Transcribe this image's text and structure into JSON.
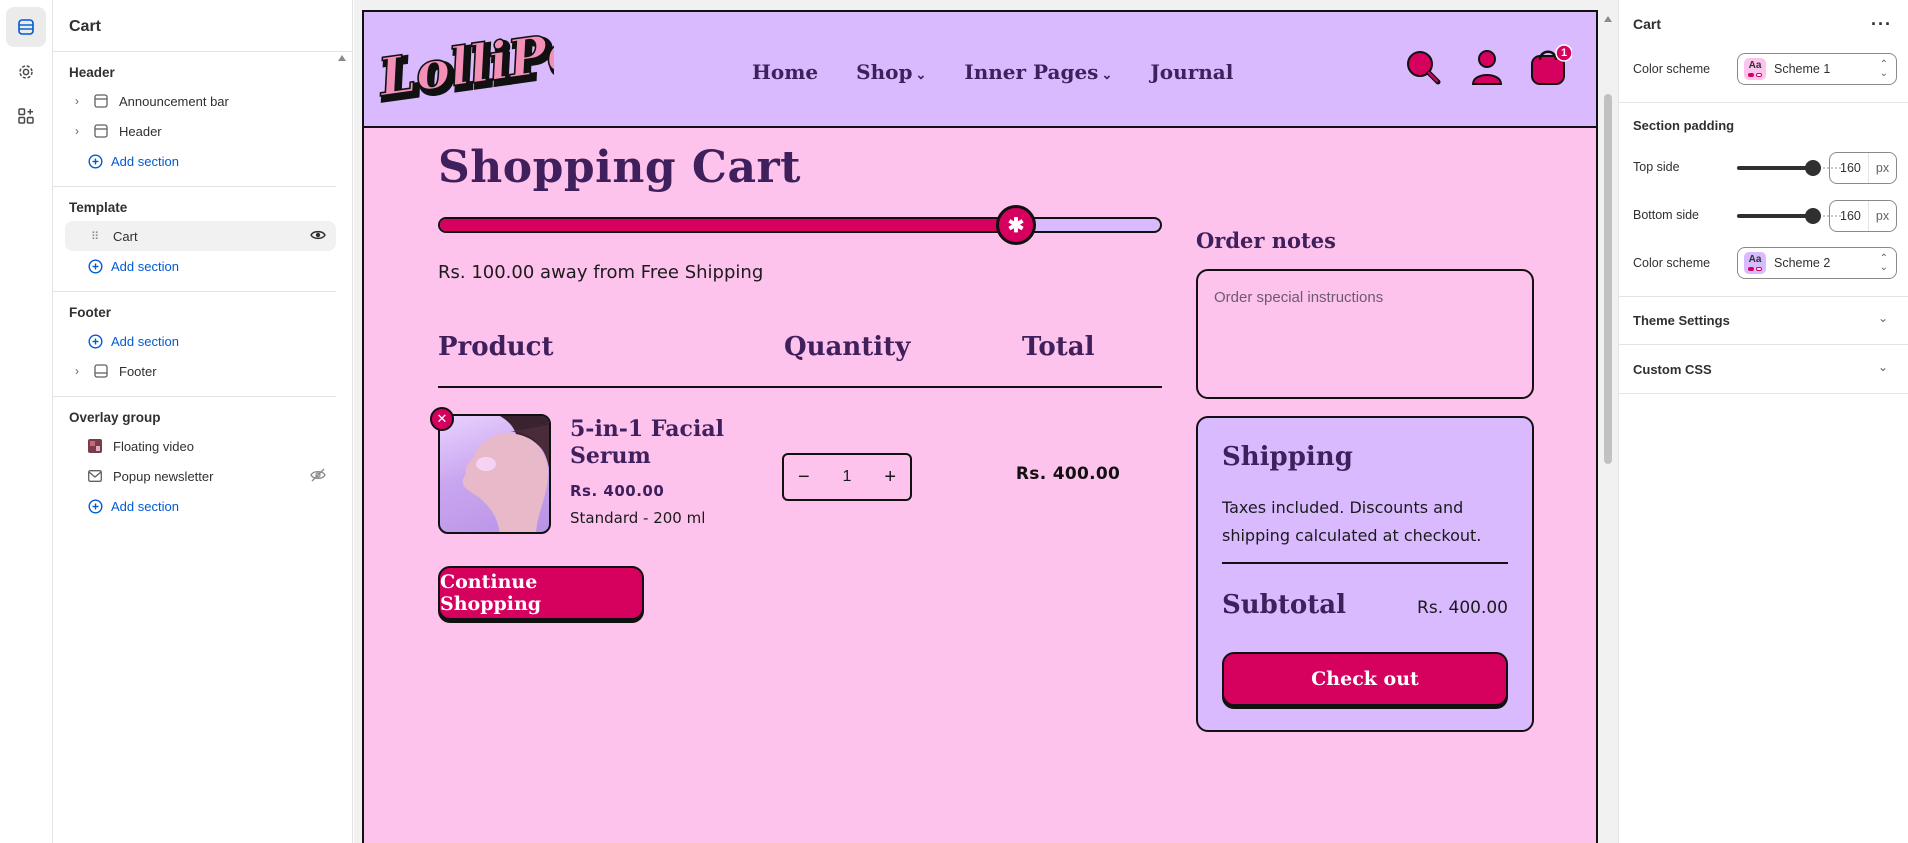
{
  "left_panel": {
    "title": "Cart",
    "groups": {
      "header": {
        "title": "Header",
        "items": [
          "Announcement bar",
          "Header"
        ],
        "add": "Add section"
      },
      "template": {
        "title": "Template",
        "items": [
          "Cart"
        ],
        "add": "Add section"
      },
      "footer": {
        "title": "Footer",
        "add": "Add section",
        "items": [
          "Footer"
        ]
      },
      "overlay": {
        "title": "Overlay group",
        "items": [
          "Floating video",
          "Popup newsletter"
        ],
        "add": "Add section"
      }
    }
  },
  "store": {
    "logo": "LolliPop",
    "nav": [
      "Home",
      "Shop",
      "Inner Pages",
      "Journal"
    ],
    "cart_count": "1",
    "page_title": "Shopping Cart",
    "shipping_progress": 0.8,
    "free_shipping_text": "Rs. 100.00 away from Free Shipping",
    "columns": [
      "Product",
      "Quantity",
      "Total"
    ],
    "item": {
      "name": "5-in-1 Facial Serum",
      "price": "Rs. 400.00",
      "variant": "Standard - 200 ml",
      "quantity": "1",
      "total": "Rs. 400.00"
    },
    "continue_label": "Continue Shopping",
    "notes_title": "Order notes",
    "notes_placeholder": "Order special instructions",
    "shipping_title": "Shipping",
    "shipping_text": "Taxes included. Discounts and shipping calculated at checkout.",
    "subtotal_label": "Subtotal",
    "subtotal_value": "Rs. 400.00",
    "checkout_label": "Check out",
    "colors": {
      "pink_bg": "#fdc3ec",
      "lilac": "#d9baff",
      "accent": "#d6005f",
      "heading": "#40205c"
    }
  },
  "right_panel": {
    "title": "Cart",
    "color_scheme_label": "Color scheme",
    "color_scheme_1": "Scheme 1",
    "section_padding": "Section padding",
    "top_side_label": "Top side",
    "top_side_value": "160",
    "bottom_side_label": "Bottom side",
    "bottom_side_value": "160",
    "unit": "px",
    "color_scheme_2_label": "Color scheme",
    "color_scheme_2": "Scheme 2",
    "theme_settings": "Theme Settings",
    "custom_css": "Custom CSS"
  }
}
